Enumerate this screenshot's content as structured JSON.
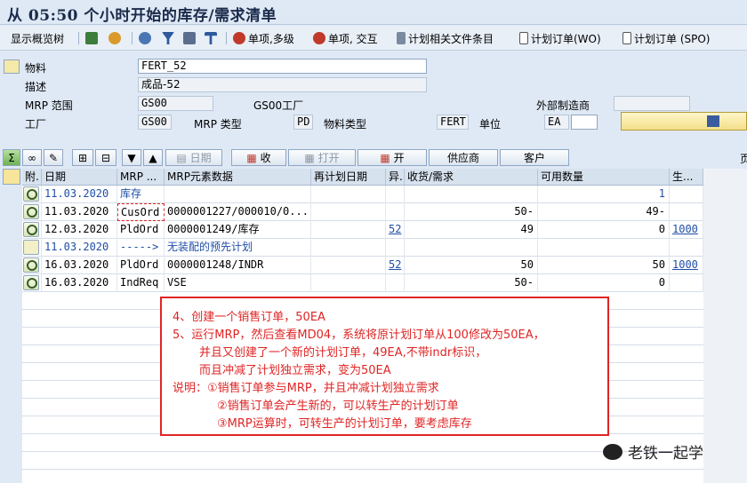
{
  "window": {
    "title": "从 05:50 个小时开始的库存/需求清单"
  },
  "toolbar": {
    "show_tree": "显示概览树",
    "single_multi": "单项,多级",
    "single_pegging": "单项, 交互",
    "plan_files": "计划相关文件条目",
    "plan_order_wo": "计划订单(WO)",
    "plan_order_spo": "计划订单 (SPO)"
  },
  "header": {
    "material_label": "物料",
    "material_value": "FERT_52",
    "desc_label": "描述",
    "desc_value": "成品-52",
    "mrp_area_label": "MRP 范围",
    "mrp_area_value": "GS00",
    "mrp_area_text": "GS00工厂",
    "ext_proc_label": "外部制造商",
    "ext_proc_value": "",
    "plant_label": "工厂",
    "plant_value": "GS00",
    "mrp_type_label": "MRP 类型",
    "mrp_type_value": "PD",
    "mat_type_label": "物料类型",
    "mat_type_value": "FERT",
    "unit_label": "单位",
    "unit_value": "EA"
  },
  "buttons": {
    "date": "日期",
    "order": "收",
    "open": "打开",
    "open2": "开",
    "vendor": "供应商",
    "customer": "客户",
    "right_edge": "页"
  },
  "table": {
    "columns": [
      "附.",
      "日期",
      "MRP ...",
      "MRP元素数据",
      "再计划日期",
      "异.",
      "收货/需求",
      "可用数量",
      "生..."
    ],
    "rows": [
      {
        "date": "11.03.2020",
        "mrp": "库存",
        "data": "",
        "redate": "",
        "exc": "",
        "qty": "",
        "avail": "1",
        "prod": "",
        "style": "blue"
      },
      {
        "date": "11.03.2020",
        "mrp": "CusOrd",
        "data": "0000001227/000010/0...",
        "redate": "",
        "exc": "",
        "qty": "50-",
        "avail": "49-",
        "prod": "",
        "style": ""
      },
      {
        "date": "12.03.2020",
        "mrp": "PldOrd",
        "data": "0000001249/库存",
        "redate": "",
        "exc": "52",
        "qty": "49",
        "avail": "0",
        "prod": "1000",
        "style": ""
      },
      {
        "date": "11.03.2020",
        "mrp": "----->",
        "data": "无装配的预先计划",
        "redate": "",
        "exc": "",
        "qty": "",
        "avail": "",
        "prod": "",
        "style": "blue"
      },
      {
        "date": "16.03.2020",
        "mrp": "PldOrd",
        "data": "0000001248/INDR",
        "redate": "",
        "exc": "52",
        "qty": "50",
        "avail": "50",
        "prod": "1000",
        "style": ""
      },
      {
        "date": "16.03.2020",
        "mrp": "IndReq",
        "data": "VSE",
        "redate": "",
        "exc": "",
        "qty": "50-",
        "avail": "0",
        "prod": "",
        "style": ""
      }
    ]
  },
  "annotation": {
    "line1": "4、创建一个销售订单，50EA",
    "line2": "5、运行MRP，然后查看MD04，系统将原计划订单从100修改为50EA，",
    "line3": "并且又创建了一个新的计划订单，49EA,不带indr标识，",
    "line4": "而且冲减了计划独立需求，变为50EA",
    "line5": "说明：①销售订单参与MRP，并且冲减计划独立需求",
    "line6": "②销售订单会产生新的，可以转生产的计划订单",
    "line7": "③MRP运算时，可转生产的计划订单，要考虑库存"
  },
  "watermark": {
    "text": "老铁一起学"
  },
  "colors": {
    "annotation_red": "#e02424",
    "link_blue": "#1f4ea8",
    "background": "#dfe9f5"
  }
}
